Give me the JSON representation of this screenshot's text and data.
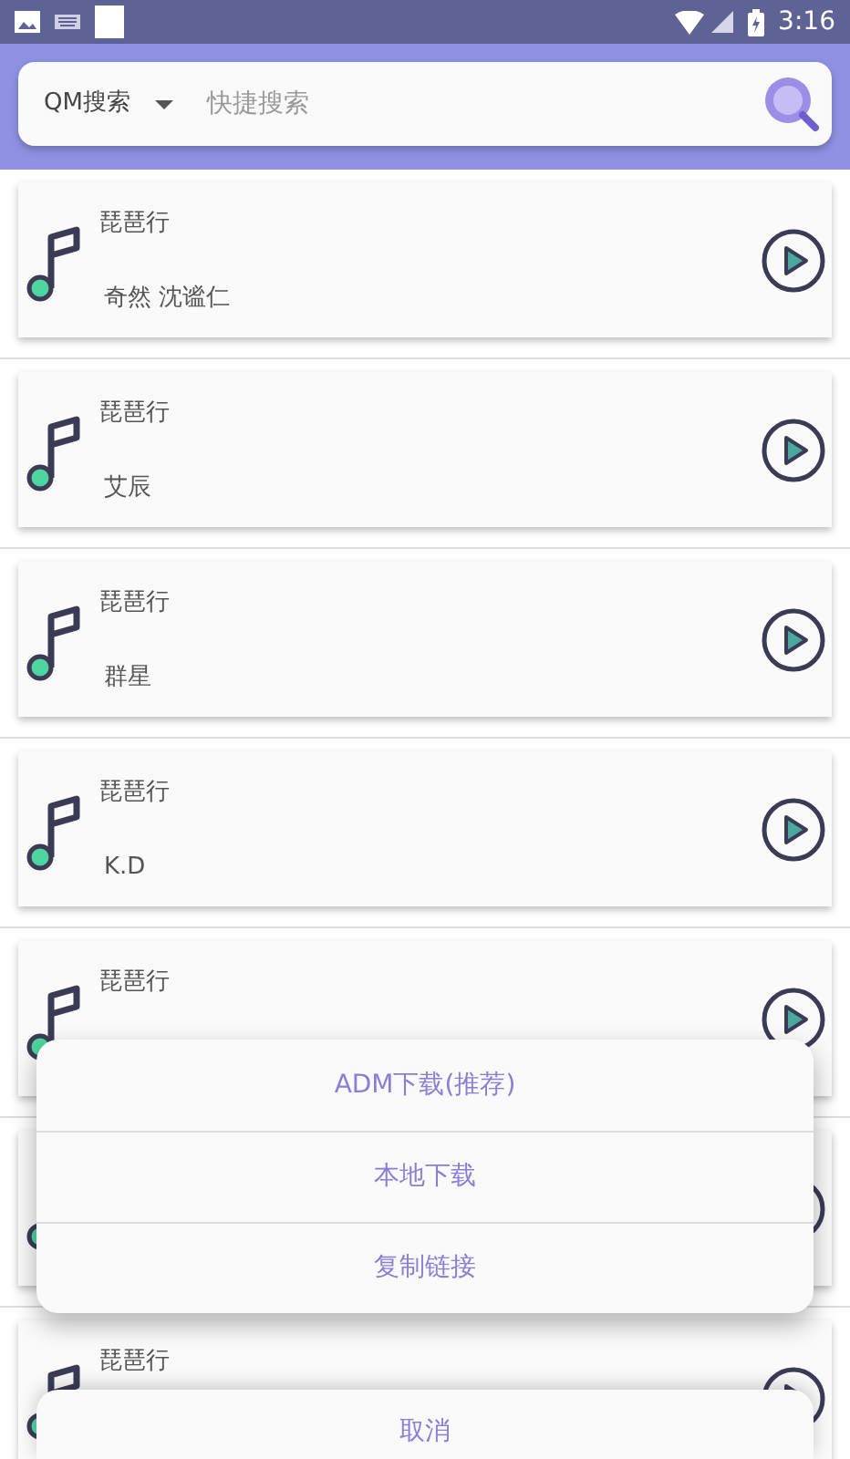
{
  "status_bar": {
    "time": "3:16"
  },
  "search": {
    "source": "QM搜索",
    "placeholder": "快捷搜索"
  },
  "songs": [
    {
      "kind": "song",
      "title": "琵琶行",
      "artist": "奇然 沈谧仁"
    },
    {
      "kind": "song",
      "title": "琵琶行",
      "artist": "艾辰"
    },
    {
      "kind": "song",
      "title": "琵琶行",
      "artist": "群星"
    },
    {
      "kind": "song",
      "title": "琵琶行",
      "artist": "K.D"
    },
    {
      "kind": "song",
      "title": "琵琶行"
    },
    {
      "kind": "song"
    },
    {
      "kind": "song",
      "title": "琵琶行"
    }
  ],
  "action_sheet": {
    "options": [
      "ADM下载(推荐)",
      "本地下载",
      "复制链接"
    ],
    "cancel": "取消"
  }
}
